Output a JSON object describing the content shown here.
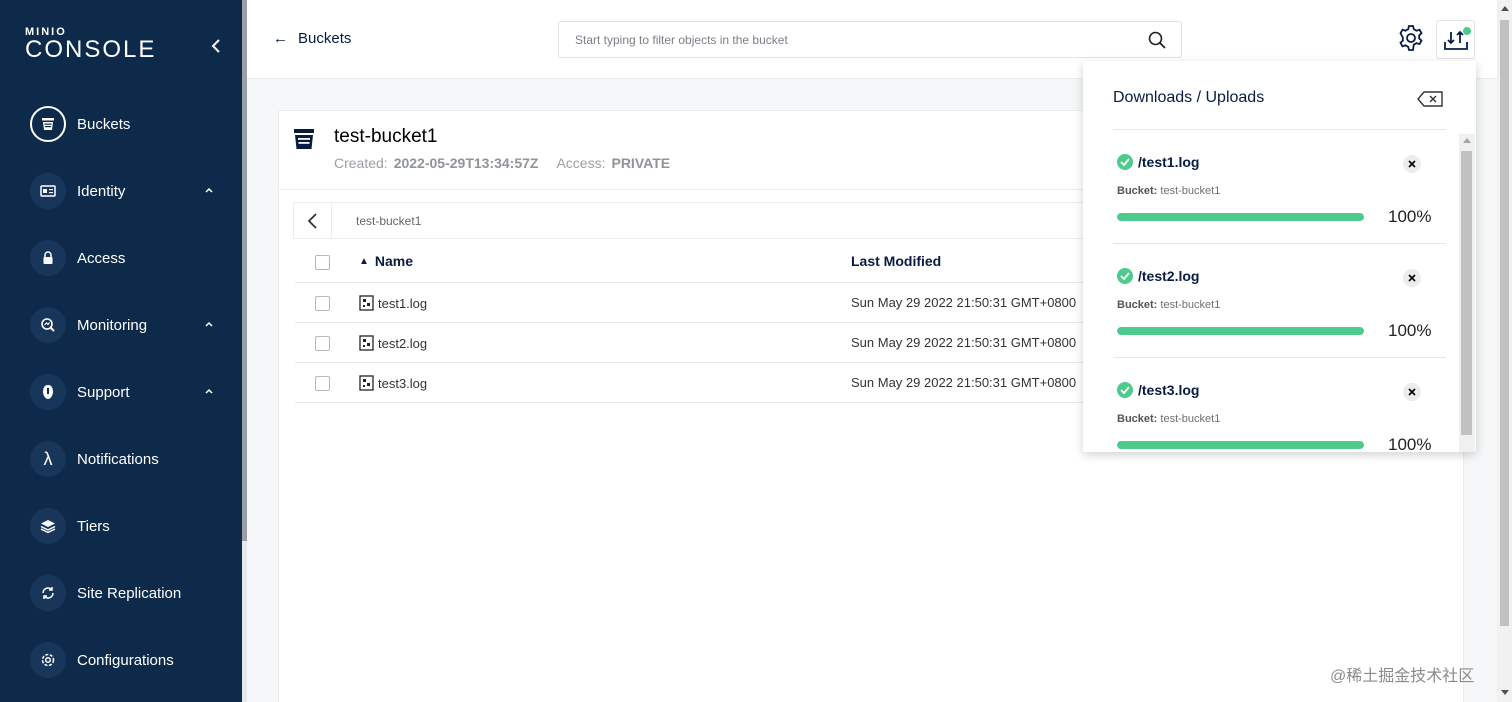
{
  "logo": {
    "small": "MINIO",
    "big": "CONSOLE"
  },
  "sidebar": {
    "items": [
      {
        "label": "Buckets",
        "icon": "bucket-icon",
        "active": true
      },
      {
        "label": "Identity",
        "icon": "id-card-icon",
        "expandable": true
      },
      {
        "label": "Access",
        "icon": "lock-icon"
      },
      {
        "label": "Monitoring",
        "icon": "magnifier-chart-icon",
        "expandable": true
      },
      {
        "label": "Support",
        "icon": "support-icon",
        "expandable": true
      },
      {
        "label": "Notifications",
        "icon": "lambda-icon"
      },
      {
        "label": "Tiers",
        "icon": "layers-icon"
      },
      {
        "label": "Site Replication",
        "icon": "sync-icon"
      },
      {
        "label": "Configurations",
        "icon": "gear-icon"
      }
    ]
  },
  "header": {
    "back_label": "Buckets",
    "search_placeholder": "Start typing to filter objects in the bucket"
  },
  "bucket": {
    "name": "test-bucket1",
    "created_label": "Created:",
    "created_value": "2022-05-29T13:34:57Z",
    "access_label": "Access:",
    "access_value": "PRIVATE"
  },
  "breadcrumb": {
    "path": "test-bucket1"
  },
  "table": {
    "columns": {
      "name": "Name",
      "modified": "Last Modified"
    },
    "rows": [
      {
        "name": "test1.log",
        "modified": "Sun May 29 2022 21:50:31 GMT+0800"
      },
      {
        "name": "test2.log",
        "modified": "Sun May 29 2022 21:50:31 GMT+0800"
      },
      {
        "name": "test3.log",
        "modified": "Sun May 29 2022 21:50:31 GMT+0800"
      }
    ]
  },
  "downloads": {
    "title": "Downloads / Uploads",
    "items": [
      {
        "file": "/test1.log",
        "bucket_label": "Bucket:",
        "bucket": "test-bucket1",
        "percent": "100%",
        "progress": 1.0
      },
      {
        "file": "/test2.log",
        "bucket_label": "Bucket:",
        "bucket": "test-bucket1",
        "percent": "100%",
        "progress": 1.0
      },
      {
        "file": "/test3.log",
        "bucket_label": "Bucket:",
        "bucket": "test-bucket1",
        "percent": "100%",
        "progress": 1.0
      }
    ]
  },
  "colors": {
    "sidebar": "#0d2a4b",
    "progress": "#4ccb8d",
    "accent": "#081c42"
  },
  "watermark": "@稀土掘金技术社区"
}
